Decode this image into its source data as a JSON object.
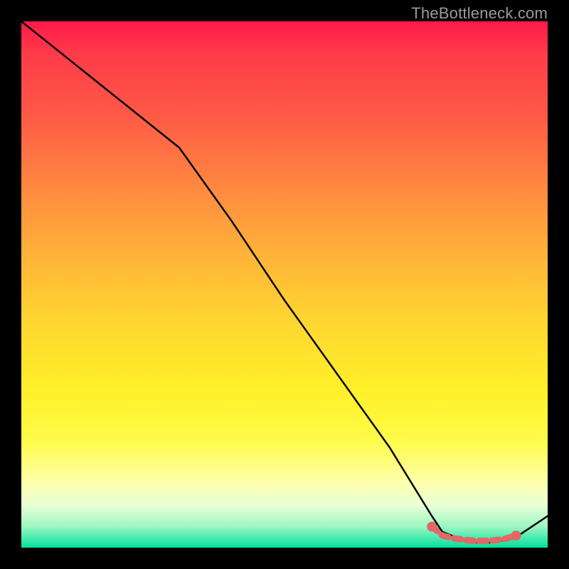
{
  "watermark": "TheBottleneck.com",
  "chart_data": {
    "type": "line",
    "title": "",
    "xlabel": "",
    "ylabel": "",
    "xlim": [
      0,
      100
    ],
    "ylim": [
      0,
      100
    ],
    "series": [
      {
        "name": "bottleneck-curve",
        "x": [
          0,
          10,
          20,
          30,
          40,
          50,
          60,
          70,
          78,
          80,
          85,
          90,
          94,
          100
        ],
        "values": [
          100,
          92,
          84,
          76,
          62,
          47,
          33,
          19,
          6,
          3,
          1,
          1,
          2,
          6
        ]
      }
    ],
    "highlight_segment": {
      "name": "optimal-range-marker",
      "x": [
        78,
        80,
        82,
        84,
        86,
        88,
        90,
        92,
        94
      ],
      "values": [
        4,
        2.3,
        1.8,
        1.5,
        1.3,
        1.3,
        1.4,
        1.7,
        2.3
      ]
    },
    "colors": {
      "curve": "#000000",
      "marker": "#e26868"
    }
  }
}
